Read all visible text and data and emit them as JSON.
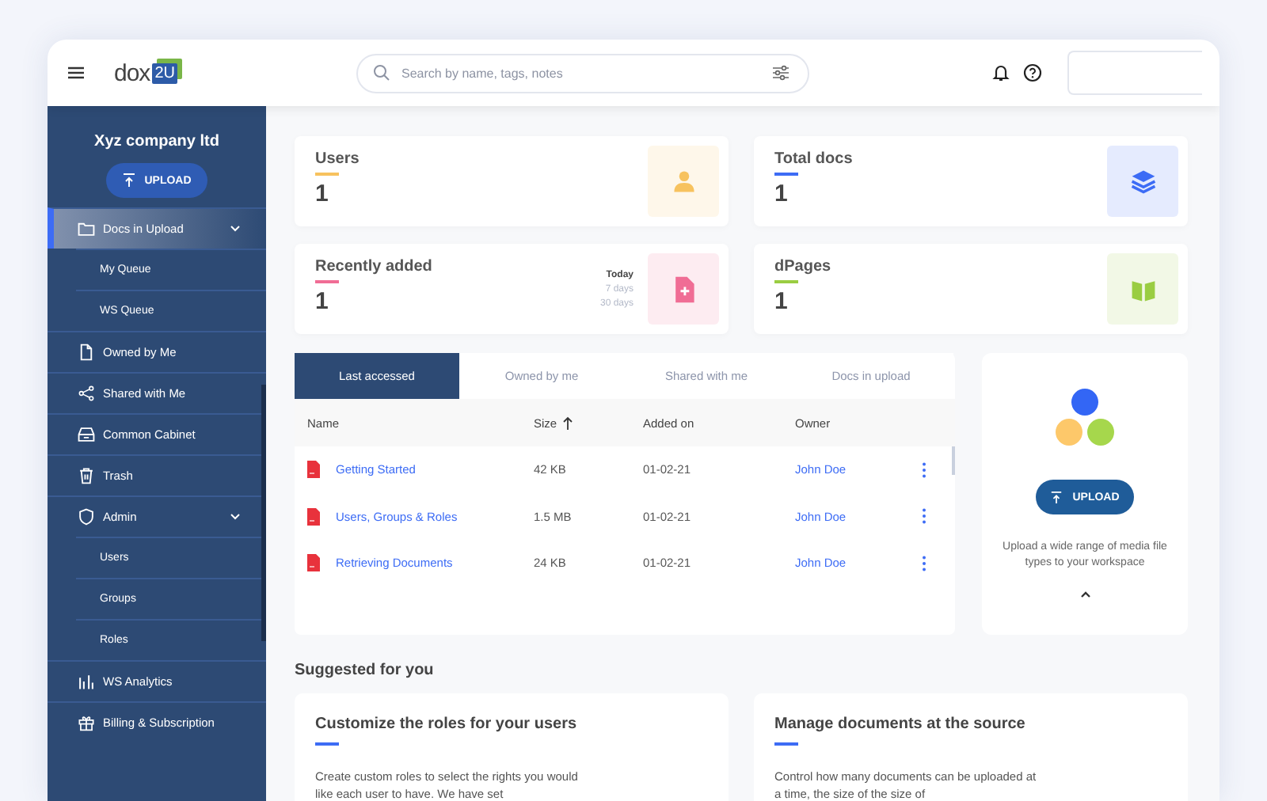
{
  "header": {
    "logo_text": "dox",
    "logo_badge": "2U",
    "search": {
      "placeholder": "Search by name, tags, notes"
    }
  },
  "sidebar": {
    "company": "Xyz company ltd",
    "upload_button": "UPLOAD",
    "items": [
      {
        "label": "Docs in Upload",
        "selected": true,
        "expanded": true,
        "children": [
          {
            "label": "My Queue",
            "selected": false
          },
          {
            "label": "WS Queue",
            "selected": false
          }
        ]
      },
      {
        "label": "Owned by Me",
        "selected": false
      },
      {
        "label": "Shared with Me",
        "selected": false
      },
      {
        "label": "Common Cabinet",
        "selected": false
      },
      {
        "label": "Trash",
        "selected": false
      },
      {
        "label": "Admin",
        "selected": false,
        "expanded": true,
        "children": [
          {
            "label": "Users",
            "selected": false
          },
          {
            "label": "Groups",
            "selected": false
          },
          {
            "label": "Roles",
            "selected": false
          }
        ]
      },
      {
        "label": "WS Analytics",
        "selected": false
      },
      {
        "label": "Billing & Subscription",
        "selected": false
      }
    ]
  },
  "stats": [
    {
      "label": "Users",
      "value": "1",
      "color": "#f7c25e"
    },
    {
      "label": "Total docs",
      "value": "1",
      "color": "#3d6cf5"
    },
    {
      "label": "Recently added",
      "value": "1",
      "color": "#f06d95",
      "periods": [
        {
          "label": "Today",
          "selected": true
        },
        {
          "label": "7 days",
          "selected": false
        },
        {
          "label": "30 days",
          "selected": false
        }
      ]
    },
    {
      "label": "dPages",
      "value": "1",
      "color": "#9acd42"
    }
  ],
  "documents": {
    "tabs": [
      {
        "label": "Last accessed",
        "selected": true
      },
      {
        "label": "Owned by me",
        "selected": false
      },
      {
        "label": "Shared with me",
        "selected": false
      },
      {
        "label": "Docs in upload",
        "selected": false
      }
    ],
    "columns": [
      {
        "label": "Name",
        "sorted": false
      },
      {
        "label": "Size",
        "sorted": true
      },
      {
        "label": "Added on",
        "sorted": false
      },
      {
        "label": "Owner",
        "sorted": false
      }
    ],
    "rows": [
      {
        "name": "Getting Started",
        "size": "42 KB",
        "added_on": "01-02-21",
        "owner": "John Doe"
      },
      {
        "name": "Users, Groups & Roles",
        "size": "1.5 MB",
        "added_on": "01-02-21",
        "owner": "John Doe"
      },
      {
        "name": "Retrieving Documents",
        "size": "24 KB",
        "added_on": "01-02-21",
        "owner": "John Doe"
      }
    ]
  },
  "upload_panel": {
    "button": "UPLOAD",
    "text": "Upload a wide range of media file types to your workspace"
  },
  "suggested": {
    "title": "Suggested for you",
    "cards": [
      {
        "title": "Customize the roles for your users",
        "text": "Create custom roles to select the rights you would  like each user to have. We have set"
      },
      {
        "title": "Manage documents at the source",
        "text": "Control how many documents can be uploaded at a time, the size of the size of"
      }
    ]
  }
}
